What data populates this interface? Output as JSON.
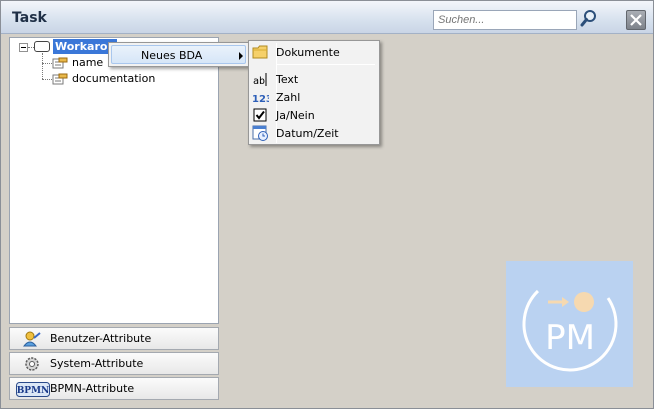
{
  "window": {
    "title": "Task"
  },
  "search": {
    "placeholder": "Suchen...",
    "icon": "magnifier-icon"
  },
  "close": {
    "icon": "close-icon"
  },
  "tree": {
    "root_label": "Workarou",
    "children": [
      {
        "label": "name",
        "icon": "attribute-icon"
      },
      {
        "label": "documentation",
        "icon": "attribute-icon"
      }
    ]
  },
  "context_menu": {
    "item_label": "Neues BDA",
    "submenu": [
      {
        "label": "Dokumente",
        "icon": "folder-icon"
      },
      {
        "label": "Text",
        "icon": "text-ab-icon"
      },
      {
        "label": "Zahl",
        "icon": "number-123-icon"
      },
      {
        "label": "Ja/Nein",
        "icon": "checkbox-icon"
      },
      {
        "label": "Datum/Zeit",
        "icon": "calendar-clock-icon"
      }
    ]
  },
  "bottom_buttons": [
    {
      "label": "Benutzer-Attribute",
      "icon": "user-attributes-icon"
    },
    {
      "label": "System-Attribute",
      "icon": "gear-icon"
    },
    {
      "label": "BPMN-Attribute",
      "icon": "bpmn-icon",
      "icon_text": "BPMN"
    }
  ],
  "logo": {
    "text": "PM",
    "icon": "pm-logo-icon"
  },
  "colors": {
    "selection": "#3a77d8",
    "logo_bg": "#bad2f1",
    "menu_hover": "#d6e6f8"
  }
}
